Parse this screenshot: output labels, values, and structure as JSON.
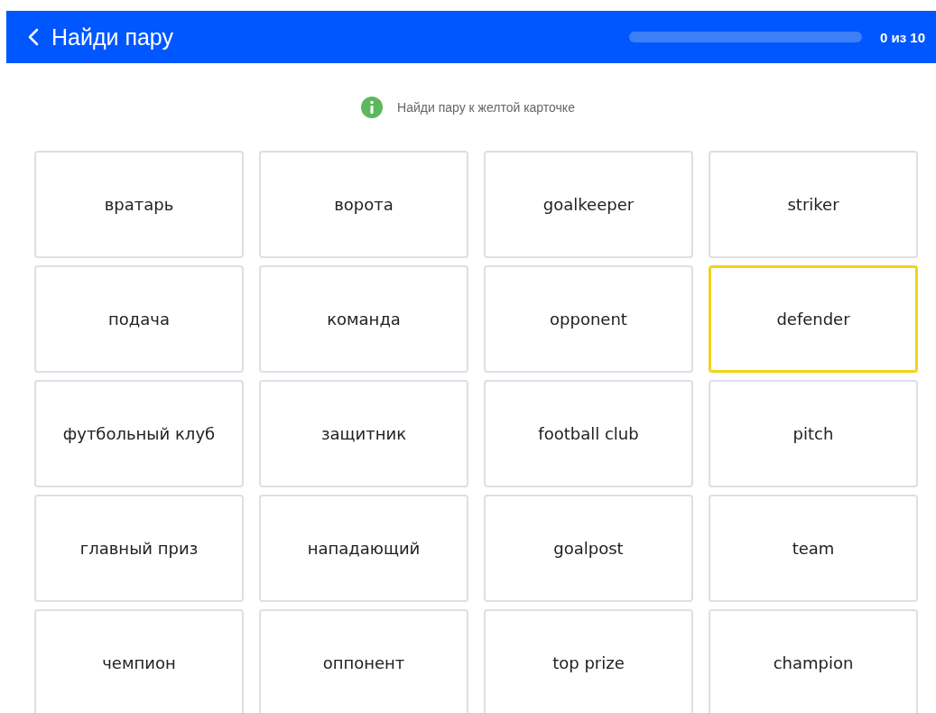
{
  "header": {
    "title": "Найди пару",
    "progress": {
      "level": 0
    },
    "counter": "0 из 10"
  },
  "hint": "Найди пару к желтой карточке",
  "cards": [
    {
      "label": "вратарь",
      "selected": false
    },
    {
      "label": "ворота",
      "selected": false
    },
    {
      "label": "goalkeeper",
      "selected": false
    },
    {
      "label": "striker",
      "selected": false
    },
    {
      "label": "подача",
      "selected": false
    },
    {
      "label": "команда",
      "selected": false
    },
    {
      "label": "opponent",
      "selected": false
    },
    {
      "label": "defender",
      "selected": true
    },
    {
      "label": "футбольный клуб",
      "selected": false
    },
    {
      "label": "защитник",
      "selected": false
    },
    {
      "label": "football club",
      "selected": false
    },
    {
      "label": "pitch",
      "selected": false
    },
    {
      "label": "главный приз",
      "selected": false
    },
    {
      "label": "нападающий",
      "selected": false
    },
    {
      "label": "goalpost",
      "selected": false
    },
    {
      "label": "team",
      "selected": false
    },
    {
      "label": "чемпион",
      "selected": false
    },
    {
      "label": "оппонент",
      "selected": false
    },
    {
      "label": "top prize",
      "selected": false
    },
    {
      "label": "champion",
      "selected": false
    }
  ]
}
